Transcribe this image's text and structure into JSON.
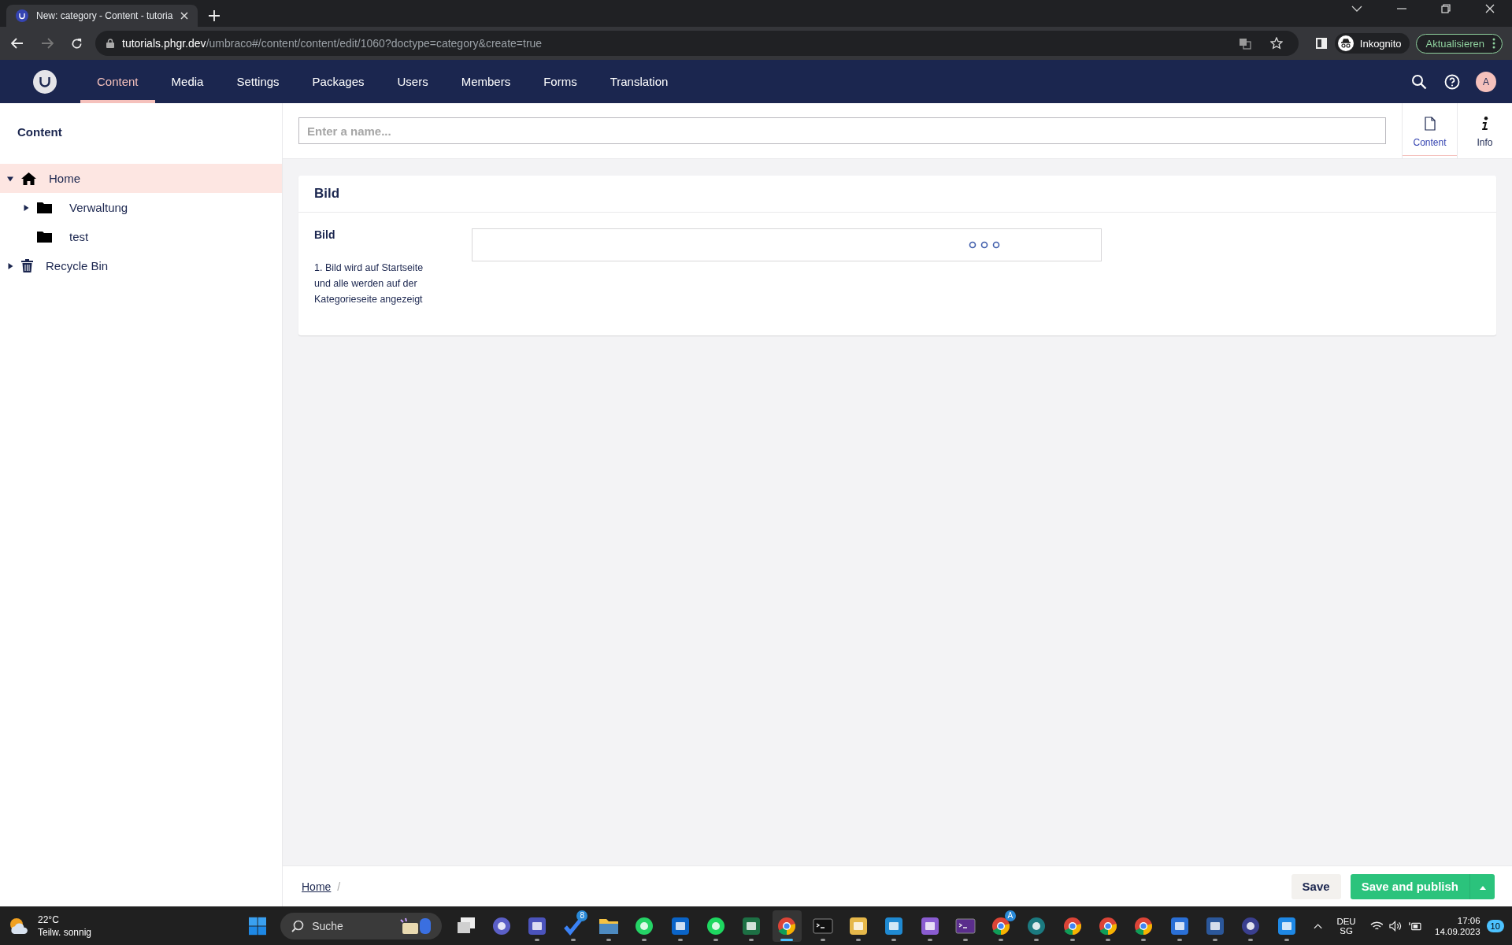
{
  "browser": {
    "tab_title": "New: category - Content - tutoria",
    "url_host": "tutorials.phgr.dev",
    "url_path": "/umbraco#/content/content/edit/1060?doctype=category&create=true",
    "forward_disabled": true,
    "profile_label": "Inkognito",
    "update_button": "Aktualisieren"
  },
  "app_nav": {
    "sections": [
      {
        "label": "Content",
        "selected": true
      },
      {
        "label": "Media",
        "selected": false
      },
      {
        "label": "Settings",
        "selected": false
      },
      {
        "label": "Packages",
        "selected": false
      },
      {
        "label": "Users",
        "selected": false
      },
      {
        "label": "Members",
        "selected": false
      },
      {
        "label": "Forms",
        "selected": false
      },
      {
        "label": "Translation",
        "selected": false
      }
    ],
    "avatar": "A"
  },
  "sidebar": {
    "title": "Content",
    "tree": [
      {
        "label": "Home",
        "kind": "home",
        "expandable": true,
        "expanded": true,
        "selected": true,
        "children": [
          {
            "label": "Verwaltung",
            "kind": "folder",
            "expandable": true,
            "expanded": false,
            "selected": false
          },
          {
            "label": "test",
            "kind": "folder",
            "expandable": false,
            "selected": false
          }
        ]
      },
      {
        "label": "Recycle Bin",
        "kind": "trash",
        "expandable": true,
        "expanded": false,
        "selected": false
      }
    ]
  },
  "editor": {
    "name_placeholder": "Enter a name...",
    "apps": [
      {
        "label": "Content",
        "kind": "document",
        "selected": true
      },
      {
        "label": "Info",
        "kind": "info",
        "selected": false
      }
    ],
    "group": {
      "title": "Bild",
      "properties": [
        {
          "label": "Bild",
          "description": "1. Bild wird auf Startseite und alle werden auf der Kategorieseite angezeigt",
          "loading": true
        }
      ]
    }
  },
  "footer": {
    "breadcrumb": [
      {
        "label": "Home",
        "separator": "/"
      }
    ],
    "save_button": "Save",
    "publish_button": "Save and publish"
  },
  "taskbar": {
    "weather": {
      "temperature": "22°C",
      "condition": "Teilw. sonnig"
    },
    "search_placeholder": "Suche",
    "apps": [
      {
        "kind": "tiles",
        "color": "#d0d0d0",
        "running": false,
        "selected": false
      },
      {
        "kind": "circle",
        "color": "#5b5fc7",
        "running": false,
        "selected": false
      },
      {
        "kind": "square",
        "color": "#4b53bc",
        "running": true,
        "selected": false
      },
      {
        "kind": "check",
        "color": "#3b82f6",
        "running": true,
        "selected": false,
        "badge": "8"
      },
      {
        "kind": "folder",
        "color": "#f5c242",
        "running": true,
        "selected": false
      },
      {
        "kind": "circle",
        "color": "#25d366",
        "running": true,
        "selected": false
      },
      {
        "kind": "square",
        "color": "#0a64c8",
        "running": true,
        "selected": false
      },
      {
        "kind": "circle",
        "color": "#1ed760",
        "running": true,
        "selected": false
      },
      {
        "kind": "square",
        "color": "#1d7044",
        "running": true,
        "selected": false
      },
      {
        "kind": "chrome",
        "color": "#db4437",
        "running": true,
        "selected": true
      },
      {
        "kind": "terminal",
        "color": "#111111",
        "running": true,
        "selected": false
      },
      {
        "kind": "square",
        "color": "#e6b84a",
        "running": true,
        "selected": false
      },
      {
        "kind": "square",
        "color": "#1f8ad2",
        "running": true,
        "selected": false
      },
      {
        "kind": "square",
        "color": "#8a5cd1",
        "running": true,
        "selected": false
      },
      {
        "kind": "terminal",
        "color": "#5a2d8c",
        "running": true,
        "selected": false
      },
      {
        "kind": "chrome",
        "color": "#db4437",
        "running": true,
        "selected": false,
        "badge": "A"
      },
      {
        "kind": "circle",
        "color": "#1b7a80",
        "running": true,
        "selected": false
      },
      {
        "kind": "chrome",
        "color": "#db4437",
        "running": true,
        "selected": false
      },
      {
        "kind": "chrome",
        "color": "#db4437",
        "running": true,
        "selected": false
      },
      {
        "kind": "chrome",
        "color": "#db4437",
        "running": true,
        "selected": false
      },
      {
        "kind": "square",
        "color": "#2a6fd6",
        "running": true,
        "selected": false
      },
      {
        "kind": "square",
        "color": "#2b579a",
        "running": true,
        "selected": false
      },
      {
        "kind": "circle",
        "color": "#3a3f8f",
        "running": true,
        "selected": false
      },
      {
        "kind": "square",
        "color": "#1e88e5",
        "running": true,
        "selected": false
      }
    ],
    "tray": {
      "language": "DEU",
      "layout": "SG",
      "time": "17:06",
      "date": "14.09.2023",
      "notifications": "10"
    }
  }
}
